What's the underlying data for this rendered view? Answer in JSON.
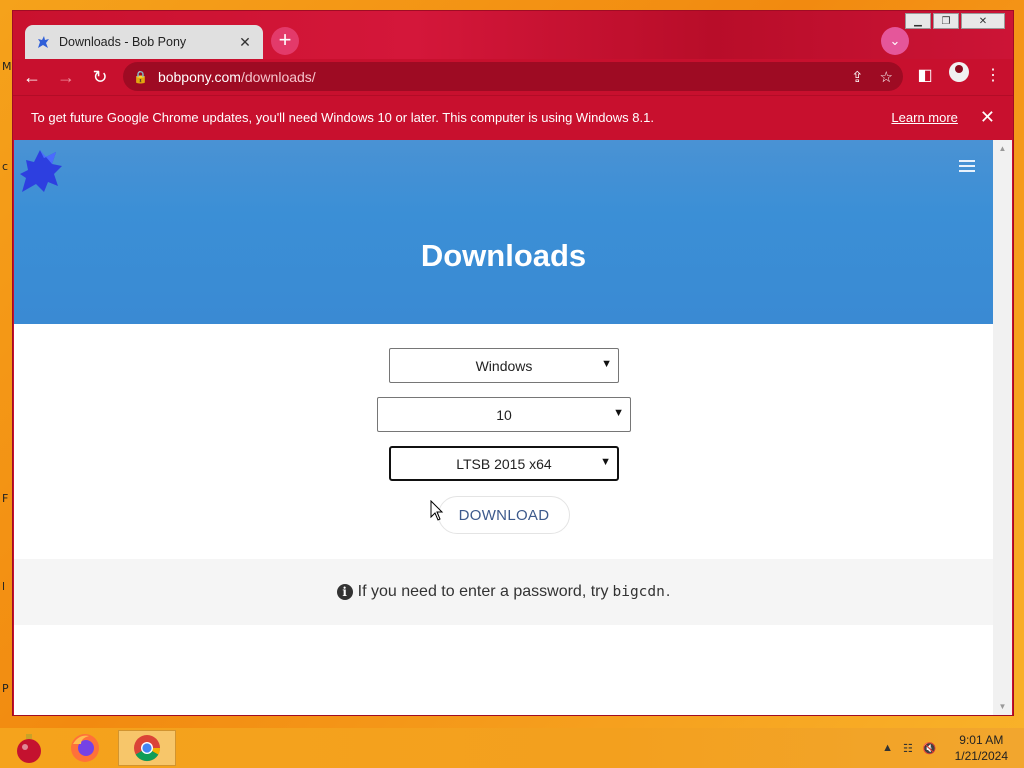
{
  "desktop_edge_letters": [
    "M",
    "c",
    "F",
    "l",
    "P"
  ],
  "window_controls": {
    "minimize": "▁",
    "restore": "❐",
    "close": "✕"
  },
  "tab": {
    "title": "Downloads - Bob Pony",
    "close": "✕"
  },
  "newtab_glyph": "+",
  "tab_search_glyph": "⌄",
  "nav": {
    "back": "←",
    "forward": "→",
    "reload": "↻"
  },
  "omnibox": {
    "lock": "🔒",
    "host": "bobpony.com",
    "path": "/downloads/",
    "share": "⇪",
    "star": "☆"
  },
  "toolbar_right": {
    "side_panel": "◧",
    "menu": "⋮"
  },
  "infobar": {
    "message": "To get future Google Chrome updates, you'll need Windows 10 or later. This computer is using Windows 8.1.",
    "learn_more": "Learn more",
    "close": "✕"
  },
  "page": {
    "heading": "Downloads",
    "os_select": {
      "value": "Windows"
    },
    "version_select": {
      "value": "10"
    },
    "edition_select": {
      "value": "LTSB 2015 x64"
    },
    "download_button": "DOWNLOAD",
    "notice": {
      "prefix": "If you need to enter a password, try",
      "password": "bigcdn",
      "suffix": "."
    }
  },
  "colors": {
    "chrome_accent": "#c8102e",
    "hero_blue": "#3b8fd6",
    "desktop_orange": "#f5a21b"
  },
  "taskbar": {
    "apps": [
      "ornament-app",
      "firefox",
      "chrome"
    ],
    "time": "9:01 AM",
    "date": "1/21/2024"
  }
}
